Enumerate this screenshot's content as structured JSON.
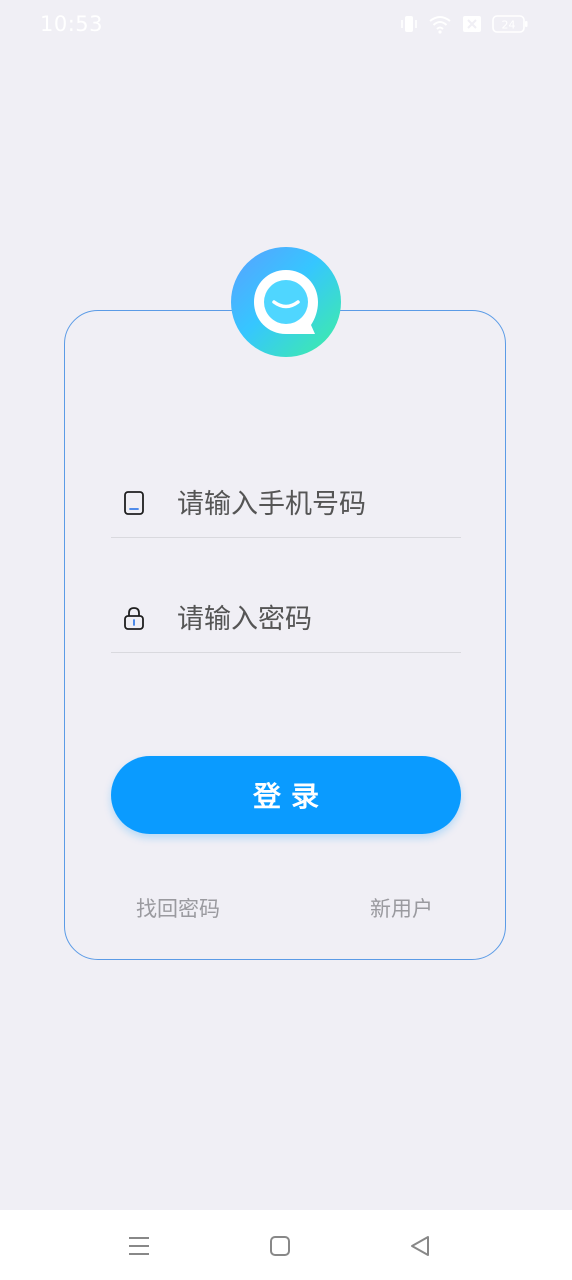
{
  "status_bar": {
    "time": "10:53",
    "battery": "24",
    "icons": [
      "vibrate-icon",
      "wifi-icon",
      "sim-x-icon",
      "battery-icon"
    ]
  },
  "logo": {
    "icon": "chat-bubble-smile-icon"
  },
  "login_form": {
    "phone_placeholder": "请输入手机号码",
    "phone_value": "",
    "password_placeholder": "请输入密码",
    "password_value": "",
    "login_label": "登录",
    "forgot_password_label": "找回密码",
    "register_label": "新用户"
  },
  "nav_bar": {
    "icons": [
      "menu-icon",
      "home-icon",
      "back-icon"
    ]
  },
  "colors": {
    "background": "#f0eff5",
    "card_border": "#5b9be6",
    "primary_button": "#0a9bff",
    "link_text": "#9a9a9f"
  }
}
